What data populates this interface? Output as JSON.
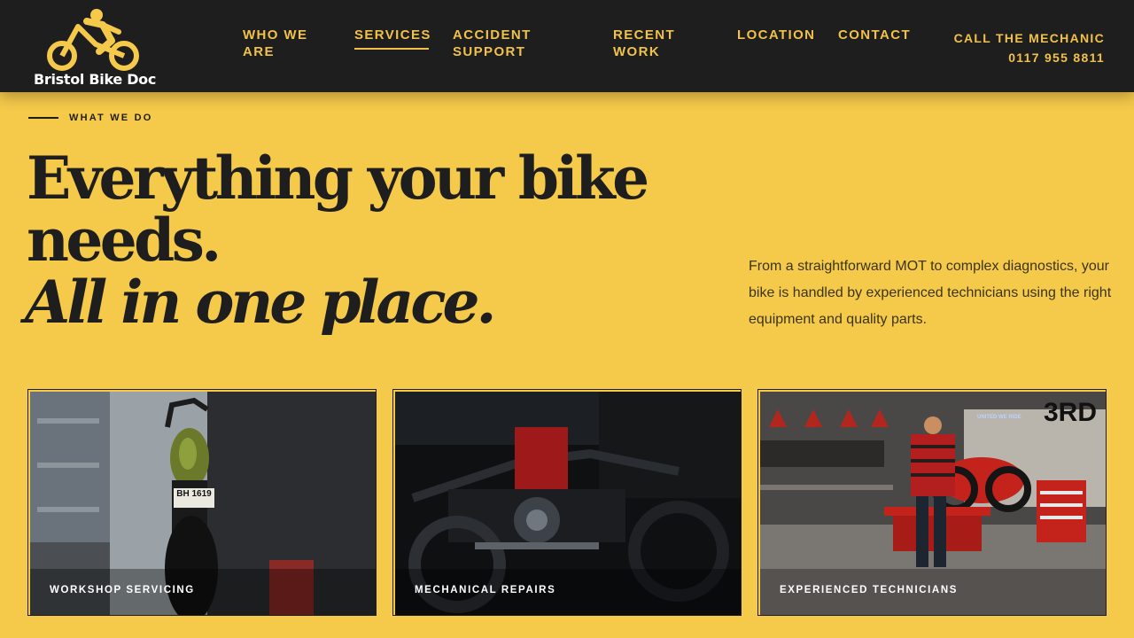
{
  "brand": {
    "name": "Bristol Bike Doc",
    "logo_icon": "motorcycle-rider-icon"
  },
  "nav": {
    "items": [
      {
        "label": "WHO WE ARE",
        "line1": "WHO WE",
        "line2": "ARE",
        "active": false
      },
      {
        "label": "SERVICES",
        "active": true
      },
      {
        "label": "ACCIDENT SUPPORT",
        "line1": "ACCIDENT",
        "line2": "SUPPORT",
        "active": false
      },
      {
        "label": "RECENT WORK",
        "line1": "RECENT",
        "line2": "WORK",
        "active": false
      },
      {
        "label": "LOCATION",
        "active": false
      },
      {
        "label": "CONTACT",
        "active": false
      }
    ]
  },
  "call": {
    "label": "CALL THE MECHANIC",
    "phone": "0117 955 8811"
  },
  "hero": {
    "eyebrow": "WHAT WE DO",
    "line1": "Everything your bike",
    "line2": "needs.",
    "line3": "All in one place.",
    "intro": "From a straightforward MOT to complex diagnostics, your bike is handled by experienced technicians using the right equipment and quality parts."
  },
  "cards": [
    {
      "label": "WORKSHOP SERVICING",
      "plate": "BH 1619"
    },
    {
      "label": "MECHANICAL REPAIRS"
    },
    {
      "label": "EXPERIENCED TECHNICIANS",
      "sign": "3RD",
      "neon": "UNITED WE RIDE"
    }
  ],
  "colors": {
    "accent": "#f5c94a",
    "dark": "#1f1e1f",
    "nav_text": "#f0c24a"
  }
}
